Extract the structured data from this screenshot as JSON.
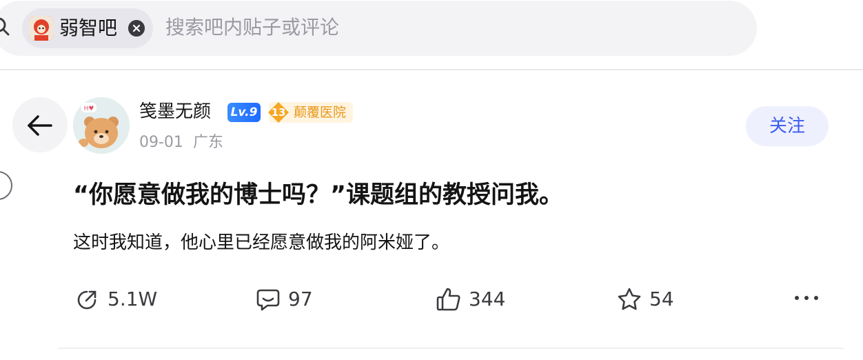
{
  "search": {
    "forum_tag": "弱智吧",
    "placeholder": "搜索吧内贴子或评论"
  },
  "post": {
    "author": {
      "name": "笺墨无颜",
      "level": "Lv.9",
      "rank_number": "13",
      "rank_title": "颠覆医院"
    },
    "date": "09-01",
    "location": "广东",
    "follow_label": "关注",
    "title": "“你愿意做我的博士吗？”课题组的教授问我。",
    "body": "这时我知道，他心里已经愿意做我的阿米娅了。"
  },
  "actions": {
    "shares": "5.1W",
    "comments": "97",
    "likes": "344",
    "favorites": "54"
  },
  "colors": {
    "accent": "#3c5cf0",
    "level_badge": "#1e6bff",
    "rank_badge": "#e8971a",
    "search_bg": "#f3f3f6"
  }
}
